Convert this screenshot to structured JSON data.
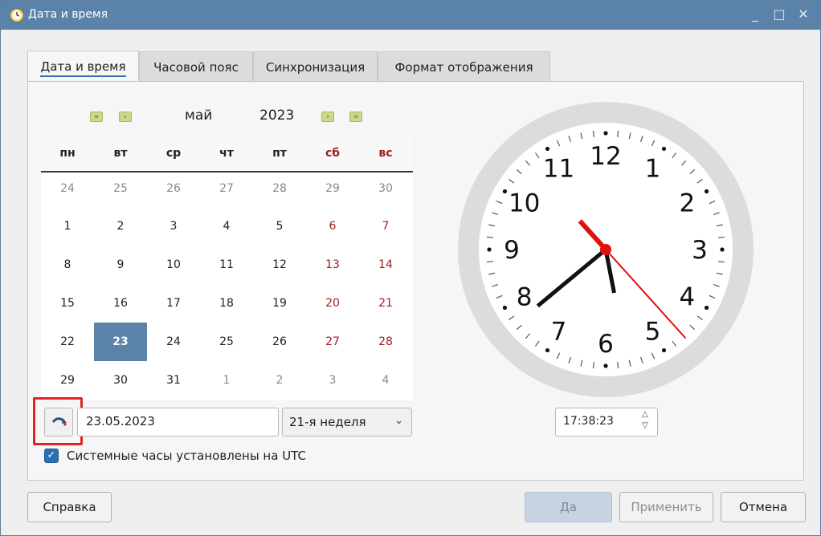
{
  "window": {
    "title": "Дата и время",
    "controls": [
      "_",
      "□",
      "✕"
    ]
  },
  "tabs": [
    {
      "label": "Дата и время",
      "active": true
    },
    {
      "label": "Часовой пояс",
      "active": false
    },
    {
      "label": "Синхронизация",
      "active": false
    },
    {
      "label": "Формат отображения",
      "active": false
    }
  ],
  "calendar": {
    "month": "май",
    "year": "2023",
    "nav": {
      "prev_year": "«",
      "prev_month": "‹",
      "next_month": "›",
      "next_year": "»"
    },
    "weekdays": [
      "пн",
      "вт",
      "ср",
      "чт",
      "пт",
      "сб",
      "вс"
    ],
    "weeks": [
      [
        "24",
        "25",
        "26",
        "27",
        "28",
        "29",
        "30"
      ],
      [
        "1",
        "2",
        "3",
        "4",
        "5",
        "6",
        "7"
      ],
      [
        "8",
        "9",
        "10",
        "11",
        "12",
        "13",
        "14"
      ],
      [
        "15",
        "16",
        "17",
        "18",
        "19",
        "20",
        "21"
      ],
      [
        "22",
        "23",
        "24",
        "25",
        "26",
        "27",
        "28"
      ],
      [
        "29",
        "30",
        "31",
        "1",
        "2",
        "3",
        "4"
      ]
    ],
    "selected_day": "23"
  },
  "date_field": {
    "value": "23.05.2023"
  },
  "week_select": {
    "value": "21-я неделя"
  },
  "utc_checkbox": {
    "label": "Системные часы установлены на UTC",
    "checked": true
  },
  "clock": {
    "numbers": [
      "12",
      "1",
      "2",
      "3",
      "4",
      "5",
      "6",
      "7",
      "8",
      "9",
      "10",
      "11"
    ],
    "hour": 17,
    "minute": 38,
    "second": 23
  },
  "time_field": {
    "value": "17:38:23"
  },
  "buttons": {
    "help": "Справка",
    "ok": "Да",
    "apply": "Применить",
    "cancel": "Отмена"
  },
  "colors": {
    "titlebar": "#5b82a9",
    "selected": "#5b82a9",
    "weekend": "#a02020",
    "highlight": "#e02424",
    "second_hand": "#e01010"
  }
}
